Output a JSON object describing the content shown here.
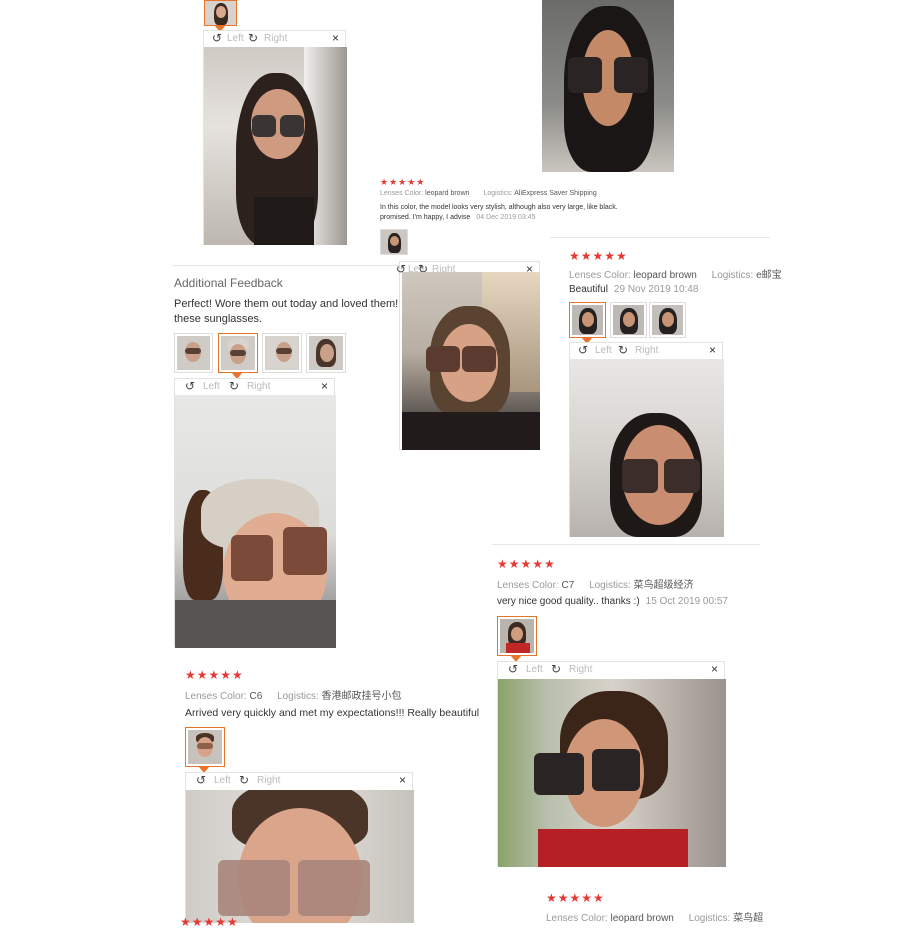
{
  "viewer_common": {
    "left_label": "Left",
    "right_label": "Right",
    "close": "×"
  },
  "review_top_left": {},
  "review_ali": {
    "stars": "★★★★★",
    "lenses_label": "Lenses Color:",
    "lenses_value": "leopard brown",
    "logistics_label": "Logistics:",
    "logistics_value": "AliExpress Saver Shipping",
    "text_line1": "In this color, the model looks very stylish, although also very large, like black.",
    "text_line2": "promised. I'm happy, I advise",
    "date": "04 Dec 2019 03:45"
  },
  "review_additional": {
    "heading": "Additional Feedback",
    "text_line1": "Perfect! Wore them out today and loved them! I",
    "text_line2": "these sunglasses."
  },
  "review_beautiful": {
    "stars": "★★★★★",
    "lenses_label": "Lenses Color:",
    "lenses_value": "leopard brown",
    "logistics_label": "Logistics:",
    "logistics_value": "e邮宝",
    "text": "Beautiful",
    "date": "29 Nov 2019 10:48"
  },
  "review_c7": {
    "stars": "★★★★★",
    "lenses_label": "Lenses Color:",
    "lenses_value": "C7",
    "logistics_label": "Logistics:",
    "logistics_value": "菜鸟超级经济",
    "text": "very nice good quality.. thanks :)",
    "date": "15 Oct 2019 00:57"
  },
  "review_c6": {
    "stars": "★★★★★",
    "lenses_label": "Lenses Color:",
    "lenses_value": "C6",
    "logistics_label": "Logistics:",
    "logistics_value": "香港邮政挂号小包",
    "text": "Arrived very quickly and met my expectations!!! Really beautiful"
  },
  "review_bottom": {
    "stars": "★★★★★",
    "lenses_label": "Lenses Color:",
    "lenses_value": "leopard brown",
    "logistics_label": "Logistics:",
    "logistics_value": "菜鸟超"
  },
  "review_bottom_left": {
    "stars": "★★★★★"
  }
}
